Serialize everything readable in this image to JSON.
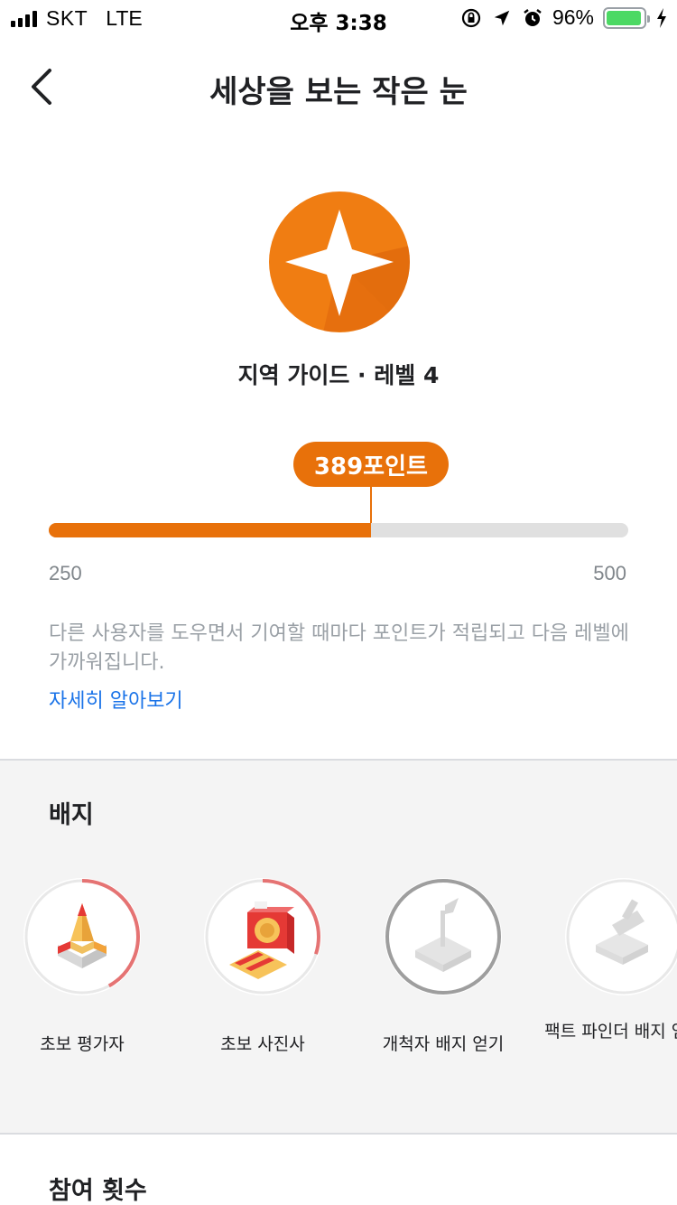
{
  "status_bar": {
    "carrier": "SKT",
    "network": "LTE",
    "time": "오후 3:38",
    "battery_percent": "96%",
    "battery_level": 0.96,
    "icons": [
      "signal-icon",
      "orientation-lock-icon",
      "location-arrow-icon",
      "alarm-icon",
      "battery-icon",
      "charging-bolt-icon"
    ]
  },
  "header": {
    "title": "세상을 보는 작은 눈",
    "back_icon": "chevron-left-icon"
  },
  "level": {
    "badge_icon": "four-point-star-icon",
    "name": "지역 가이드 · 레벨 4",
    "points_label": "389포인트",
    "points": 389,
    "range_min": "250",
    "range_max": "500",
    "description": "다른 사용자를 도우면서 기여할 때마다 포인트가 적립되고 다음 레벨에 가까워집니다.",
    "learn_more": "자세히 알아보기"
  },
  "badges": {
    "title": "배지",
    "items": [
      {
        "label": "초보 평가자",
        "icon": "pencil-badge-icon",
        "progress": 0.42
      },
      {
        "label": "초보 사진사",
        "icon": "camera-badge-icon",
        "progress": 0.3
      },
      {
        "label": "개척자 배지 얻기",
        "icon": "flag-badge-icon",
        "progress": 1.0
      },
      {
        "label": "팩트 파인더 배지 얻기",
        "icon": "telescope-badge-icon",
        "progress": 0.0
      }
    ]
  },
  "participation": {
    "title": "참여 횟수"
  },
  "colors": {
    "accent": "#e8710a",
    "link": "#1a73e8",
    "badge_progress": "#e57373",
    "badge_complete": "#9e9e9e"
  }
}
